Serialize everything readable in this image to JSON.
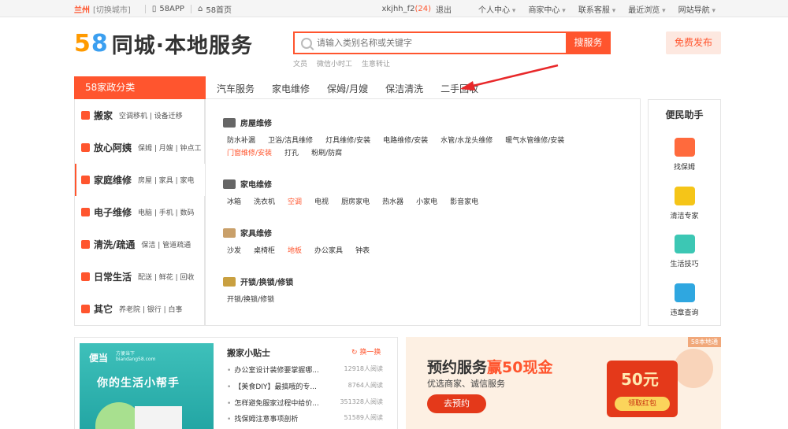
{
  "topbar": {
    "city": "兰州",
    "switch_city": "[切换城市]",
    "app": "58APP",
    "home": "58首页",
    "user": "xkjhh_f2",
    "msg_count": "(24)",
    "logout": "退出",
    "personal": "个人中心",
    "merchant": "商家中心",
    "service": "联系客服",
    "recent": "最近浏览",
    "site_nav": "网站导航"
  },
  "header": {
    "logo_5": "5",
    "logo_8": "8",
    "logo_text": "同城·本地服务",
    "search_placeholder": "请输入类别名称或关键字",
    "search_button": "搜服务",
    "hot": [
      "文员",
      "微信小时工",
      "生意转让"
    ],
    "publish_button": "免费发布"
  },
  "nav": {
    "category_title": "58家政分类",
    "tabs": [
      "汽车服务",
      "家电维修",
      "保姆/月嫂",
      "保洁清洗",
      "二手回收"
    ]
  },
  "menu": [
    {
      "title": "搬家",
      "sub": "空调移机 | 设备迁移"
    },
    {
      "title": "放心阿姨",
      "sub": "保姆 | 月嫂 | 钟点工"
    },
    {
      "title": "家庭维修",
      "sub": "房屋 | 家具 | 家电"
    },
    {
      "title": "电子维修",
      "sub": "电脑 | 手机 | 数码"
    },
    {
      "title": "清洗/疏通",
      "sub": "保洁 | 管道疏通"
    },
    {
      "title": "日常生活",
      "sub": "配送 | 鲜花 | 回收"
    },
    {
      "title": "其它",
      "sub": "养老院 | 银行 | 白事"
    }
  ],
  "groups": [
    {
      "title": "房屋维修",
      "items": [
        "防水补漏",
        "卫浴/洁具维修",
        "灯具维修/安装",
        "电路维修/安装",
        "水管/水龙头维修",
        "暖气水管维修/安装",
        "门窗维修/安装",
        "打孔",
        "粉刷/防腐"
      ]
    },
    {
      "title": "家电维修",
      "items": [
        "冰箱",
        "洗衣机",
        "空调",
        "电视",
        "厨房家电",
        "热水器",
        "小家电",
        "影音家电"
      ]
    },
    {
      "title": "家具维修",
      "items": [
        "沙发",
        "桌椅柜",
        "地板",
        "办公家具",
        "钟表"
      ]
    },
    {
      "title": "开锁/换锁/修锁",
      "items": [
        "开锁/换锁/修锁"
      ]
    }
  ],
  "helper": {
    "title": "便民助手",
    "items": [
      "找保姆",
      "清洁专家",
      "生活技巧",
      "违章查询"
    ]
  },
  "banner1": {
    "brand": "便当",
    "brand_sub1": "方便当下",
    "brand_sub2": "biandang58.com",
    "slogan": "你的生活小帮手"
  },
  "tips": {
    "title": "搬家小贴士",
    "refresh": "换一换",
    "items": [
      {
        "text": "办公室设计装修要掌握哪...",
        "views": "12918人阅读"
      },
      {
        "text": "【美食DIY】最搞哦的专...",
        "views": "8764人阅读"
      },
      {
        "text": "怎样避免服家过程中给价...",
        "views": "351328人阅读"
      },
      {
        "text": "找保姆注意事项剖析",
        "views": "51589人阅读"
      }
    ]
  },
  "banner2": {
    "tag": "58本地通",
    "title_pre": "预约服务",
    "title_hl": "赢50现金",
    "sub": "优选商家、诚信服务",
    "button": "去预约",
    "coupon_value": "50元",
    "coupon_btn": "领取红包"
  },
  "colors": {
    "accent": "#ff552e"
  }
}
